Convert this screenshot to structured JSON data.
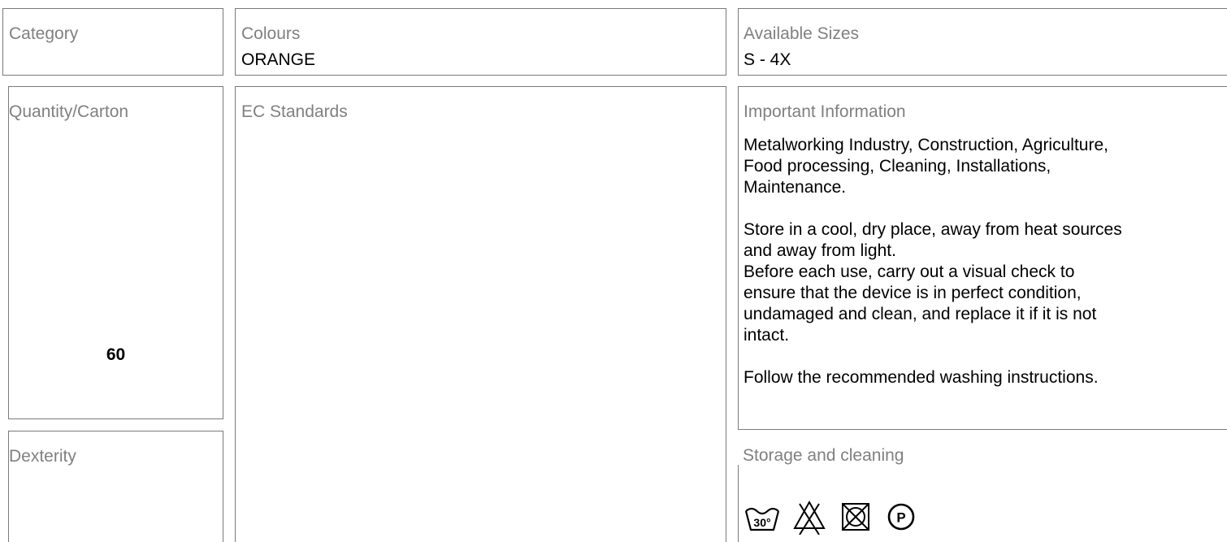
{
  "category": {
    "label": "Category"
  },
  "colours": {
    "label": "Colours",
    "value": "ORANGE"
  },
  "sizes": {
    "label": "Available Sizes",
    "value": "S - 4X"
  },
  "quantity": {
    "label": "Quantity/Carton",
    "value": "60"
  },
  "standards": {
    "label": "EC Standards"
  },
  "info": {
    "label": "Important Information",
    "lines": [
      "Metalworking Industry, Construction, Agriculture,",
      "Food processing, Cleaning, Installations,",
      "Maintenance.",
      "Store in a cool, dry place, away from heat sources",
      "and away from light.",
      "Before each use, carry out a visual check to",
      "ensure that the device is in perfect condition,",
      "undamaged and clean, and replace it if it is not",
      "intact.",
      "Follow the recommended washing instructions."
    ]
  },
  "dexterity": {
    "label": "Dexterity"
  },
  "storage": {
    "label": "Storage and cleaning",
    "icons": [
      {
        "name": "wash-30-icon",
        "text": "30°"
      },
      {
        "name": "no-bleach-icon"
      },
      {
        "name": "no-tumble-dry-icon"
      },
      {
        "name": "professional-dry-clean-icon",
        "text": "P"
      }
    ]
  }
}
